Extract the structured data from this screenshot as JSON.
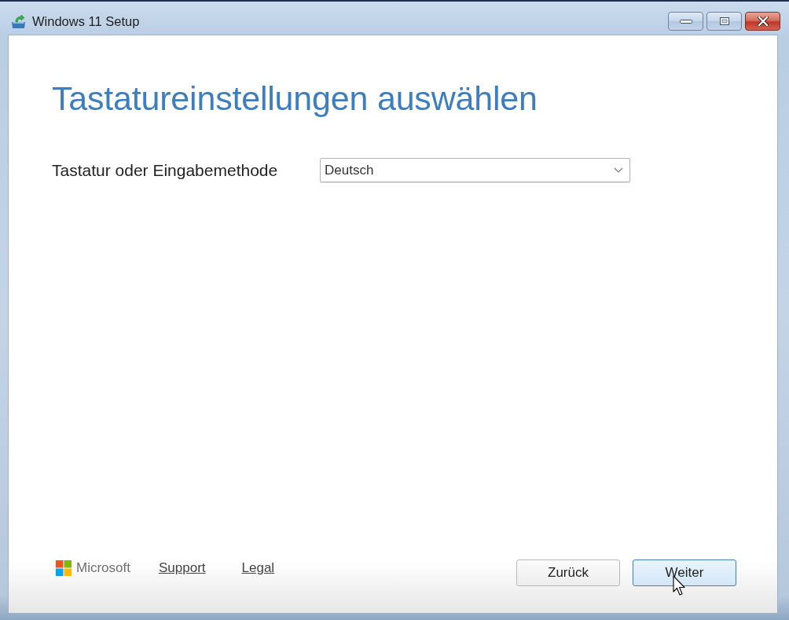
{
  "window": {
    "title": "Windows 11 Setup"
  },
  "heading": "Tastatureinstellungen auswählen",
  "fields": [
    {
      "label": "Tastatur oder Eingabemethode",
      "value": "Deutsch"
    }
  ],
  "footer": {
    "brand": "Microsoft",
    "links": [
      "Support",
      "Legal"
    ]
  },
  "buttons": [
    {
      "label": "Zurück",
      "highlighted": false
    },
    {
      "label": "Weiter",
      "highlighted": true
    }
  ]
}
